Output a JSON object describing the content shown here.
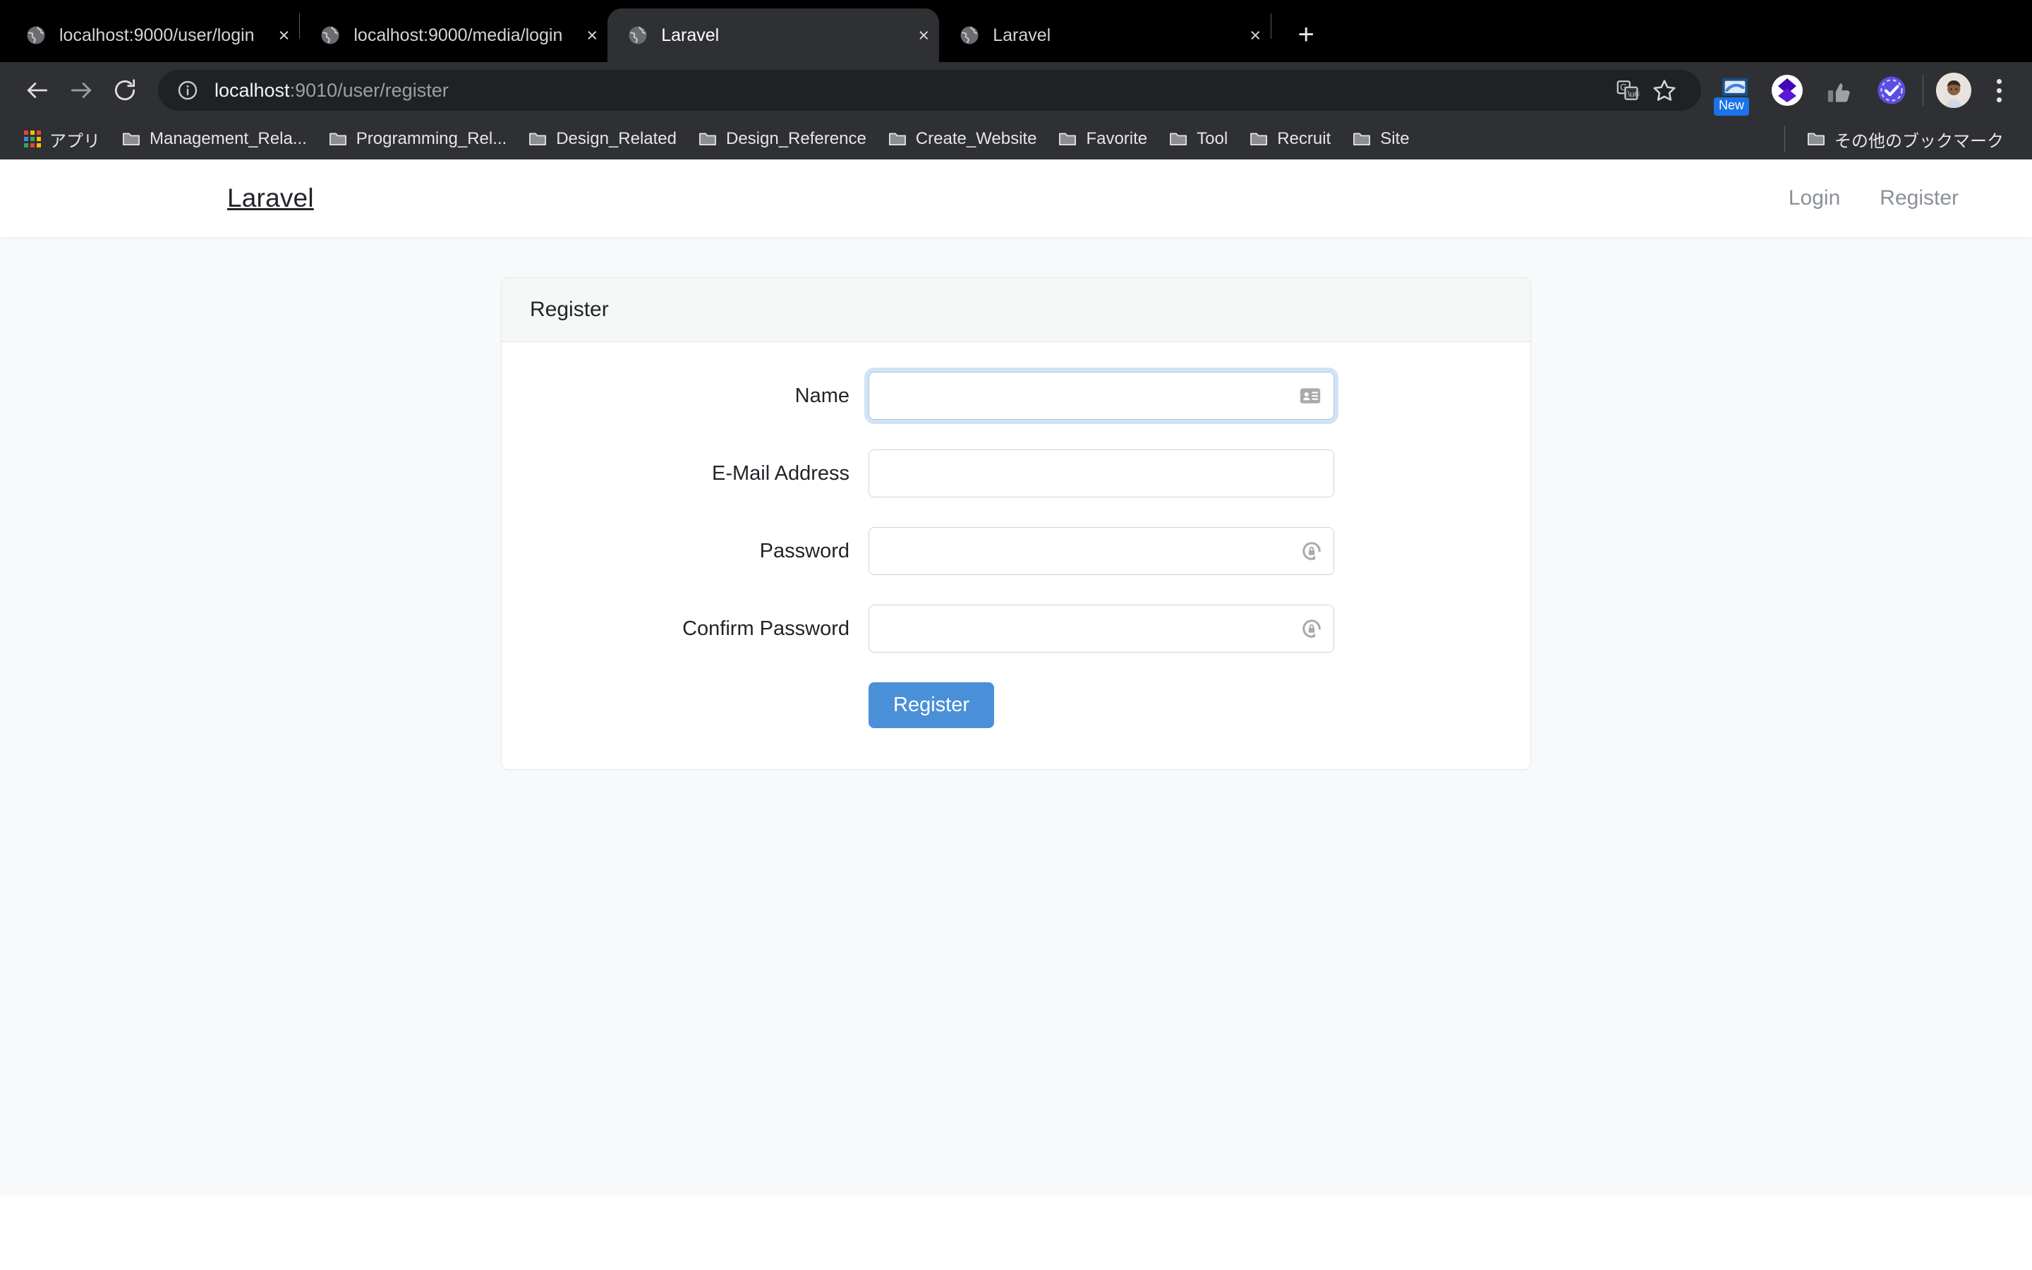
{
  "browser": {
    "tabs": [
      {
        "title": "localhost:9000/user/login",
        "active": false,
        "favicon": "globe-icon",
        "close": "×"
      },
      {
        "title": "localhost:9000/media/login",
        "active": false,
        "favicon": "globe-icon",
        "close": "×"
      },
      {
        "title": "Laravel",
        "active": true,
        "favicon": "globe-icon",
        "close": "×"
      },
      {
        "title": "Laravel",
        "active": false,
        "favicon": "globe-icon",
        "close": "×"
      }
    ],
    "new_tab_label": "+",
    "toolbar": {
      "back_icon": "back-arrow-icon",
      "forward_icon": "forward-arrow-icon",
      "reload_icon": "reload-icon",
      "site_info_icon": "info-circle-icon",
      "url_host": "localhost",
      "url_path": ":9010/user/register",
      "translate_icon": "translate-icon",
      "bookmark_star_icon": "star-icon",
      "extensions": [
        {
          "name": "screen-capture-extension-icon",
          "badge": "New"
        },
        {
          "name": "wappalyzer-extension-icon",
          "badge": ""
        },
        {
          "name": "thumbs-up-extension-icon",
          "badge": ""
        },
        {
          "name": "check-circle-extension-icon",
          "badge": ""
        }
      ],
      "avatar_name": "profile-avatar",
      "menu_icon": "three-dot-menu-icon"
    },
    "bookmarks": {
      "apps_label": "アプリ",
      "items": [
        "Management_Rela...",
        "Programming_Rel...",
        "Design_Related",
        "Design_Reference",
        "Create_Website",
        "Favorite",
        "Tool",
        "Recruit",
        "Site"
      ],
      "other_bookmarks": "その他のブックマーク"
    }
  },
  "page": {
    "navbar": {
      "brand": "Laravel",
      "links": [
        {
          "label": "Login"
        },
        {
          "label": "Register"
        }
      ]
    },
    "card": {
      "header": "Register",
      "fields": [
        {
          "label": "Name",
          "value": "",
          "placeholder": "",
          "type": "text",
          "focused": true,
          "icon": "contact-card-autofill-icon"
        },
        {
          "label": "E-Mail Address",
          "value": "",
          "placeholder": "",
          "type": "email",
          "focused": false,
          "icon": ""
        },
        {
          "label": "Password",
          "value": "",
          "placeholder": "",
          "type": "password",
          "focused": false,
          "icon": "password-manager-key-icon"
        },
        {
          "label": "Confirm Password",
          "value": "",
          "placeholder": "",
          "type": "password",
          "focused": false,
          "icon": "password-manager-key-icon"
        }
      ],
      "submit_label": "Register"
    }
  },
  "colors": {
    "accent": "#4a90d9",
    "chrome_bg": "#2f3033",
    "tabstrip_bg": "#000000",
    "page_bg": "#f8f9fa",
    "card_header_bg": "#f6f7f7",
    "focus_ring": "#a8c7ea"
  }
}
